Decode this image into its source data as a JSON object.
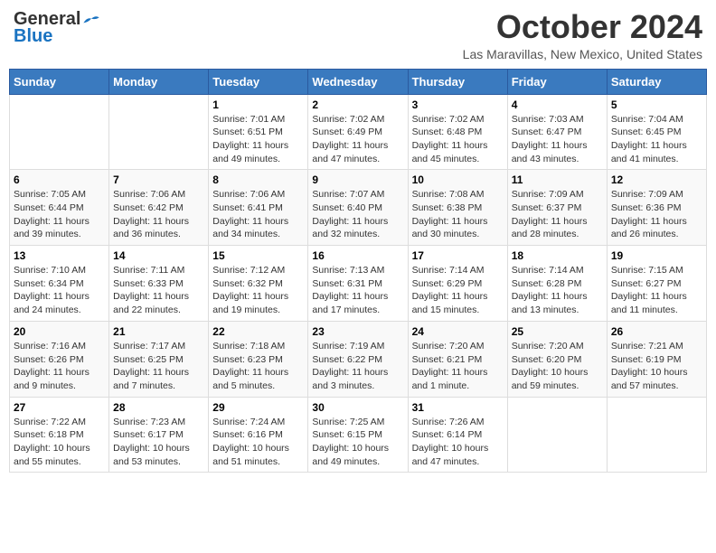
{
  "header": {
    "logo_general": "General",
    "logo_blue": "Blue",
    "month_title": "October 2024",
    "location": "Las Maravillas, New Mexico, United States"
  },
  "calendar": {
    "days_of_week": [
      "Sunday",
      "Monday",
      "Tuesday",
      "Wednesday",
      "Thursday",
      "Friday",
      "Saturday"
    ],
    "weeks": [
      [
        {
          "day": "",
          "info": ""
        },
        {
          "day": "",
          "info": ""
        },
        {
          "day": "1",
          "info": "Sunrise: 7:01 AM\nSunset: 6:51 PM\nDaylight: 11 hours and 49 minutes."
        },
        {
          "day": "2",
          "info": "Sunrise: 7:02 AM\nSunset: 6:49 PM\nDaylight: 11 hours and 47 minutes."
        },
        {
          "day": "3",
          "info": "Sunrise: 7:02 AM\nSunset: 6:48 PM\nDaylight: 11 hours and 45 minutes."
        },
        {
          "day": "4",
          "info": "Sunrise: 7:03 AM\nSunset: 6:47 PM\nDaylight: 11 hours and 43 minutes."
        },
        {
          "day": "5",
          "info": "Sunrise: 7:04 AM\nSunset: 6:45 PM\nDaylight: 11 hours and 41 minutes."
        }
      ],
      [
        {
          "day": "6",
          "info": "Sunrise: 7:05 AM\nSunset: 6:44 PM\nDaylight: 11 hours and 39 minutes."
        },
        {
          "day": "7",
          "info": "Sunrise: 7:06 AM\nSunset: 6:42 PM\nDaylight: 11 hours and 36 minutes."
        },
        {
          "day": "8",
          "info": "Sunrise: 7:06 AM\nSunset: 6:41 PM\nDaylight: 11 hours and 34 minutes."
        },
        {
          "day": "9",
          "info": "Sunrise: 7:07 AM\nSunset: 6:40 PM\nDaylight: 11 hours and 32 minutes."
        },
        {
          "day": "10",
          "info": "Sunrise: 7:08 AM\nSunset: 6:38 PM\nDaylight: 11 hours and 30 minutes."
        },
        {
          "day": "11",
          "info": "Sunrise: 7:09 AM\nSunset: 6:37 PM\nDaylight: 11 hours and 28 minutes."
        },
        {
          "day": "12",
          "info": "Sunrise: 7:09 AM\nSunset: 6:36 PM\nDaylight: 11 hours and 26 minutes."
        }
      ],
      [
        {
          "day": "13",
          "info": "Sunrise: 7:10 AM\nSunset: 6:34 PM\nDaylight: 11 hours and 24 minutes."
        },
        {
          "day": "14",
          "info": "Sunrise: 7:11 AM\nSunset: 6:33 PM\nDaylight: 11 hours and 22 minutes."
        },
        {
          "day": "15",
          "info": "Sunrise: 7:12 AM\nSunset: 6:32 PM\nDaylight: 11 hours and 19 minutes."
        },
        {
          "day": "16",
          "info": "Sunrise: 7:13 AM\nSunset: 6:31 PM\nDaylight: 11 hours and 17 minutes."
        },
        {
          "day": "17",
          "info": "Sunrise: 7:14 AM\nSunset: 6:29 PM\nDaylight: 11 hours and 15 minutes."
        },
        {
          "day": "18",
          "info": "Sunrise: 7:14 AM\nSunset: 6:28 PM\nDaylight: 11 hours and 13 minutes."
        },
        {
          "day": "19",
          "info": "Sunrise: 7:15 AM\nSunset: 6:27 PM\nDaylight: 11 hours and 11 minutes."
        }
      ],
      [
        {
          "day": "20",
          "info": "Sunrise: 7:16 AM\nSunset: 6:26 PM\nDaylight: 11 hours and 9 minutes."
        },
        {
          "day": "21",
          "info": "Sunrise: 7:17 AM\nSunset: 6:25 PM\nDaylight: 11 hours and 7 minutes."
        },
        {
          "day": "22",
          "info": "Sunrise: 7:18 AM\nSunset: 6:23 PM\nDaylight: 11 hours and 5 minutes."
        },
        {
          "day": "23",
          "info": "Sunrise: 7:19 AM\nSunset: 6:22 PM\nDaylight: 11 hours and 3 minutes."
        },
        {
          "day": "24",
          "info": "Sunrise: 7:20 AM\nSunset: 6:21 PM\nDaylight: 11 hours and 1 minute."
        },
        {
          "day": "25",
          "info": "Sunrise: 7:20 AM\nSunset: 6:20 PM\nDaylight: 10 hours and 59 minutes."
        },
        {
          "day": "26",
          "info": "Sunrise: 7:21 AM\nSunset: 6:19 PM\nDaylight: 10 hours and 57 minutes."
        }
      ],
      [
        {
          "day": "27",
          "info": "Sunrise: 7:22 AM\nSunset: 6:18 PM\nDaylight: 10 hours and 55 minutes."
        },
        {
          "day": "28",
          "info": "Sunrise: 7:23 AM\nSunset: 6:17 PM\nDaylight: 10 hours and 53 minutes."
        },
        {
          "day": "29",
          "info": "Sunrise: 7:24 AM\nSunset: 6:16 PM\nDaylight: 10 hours and 51 minutes."
        },
        {
          "day": "30",
          "info": "Sunrise: 7:25 AM\nSunset: 6:15 PM\nDaylight: 10 hours and 49 minutes."
        },
        {
          "day": "31",
          "info": "Sunrise: 7:26 AM\nSunset: 6:14 PM\nDaylight: 10 hours and 47 minutes."
        },
        {
          "day": "",
          "info": ""
        },
        {
          "day": "",
          "info": ""
        }
      ]
    ]
  }
}
